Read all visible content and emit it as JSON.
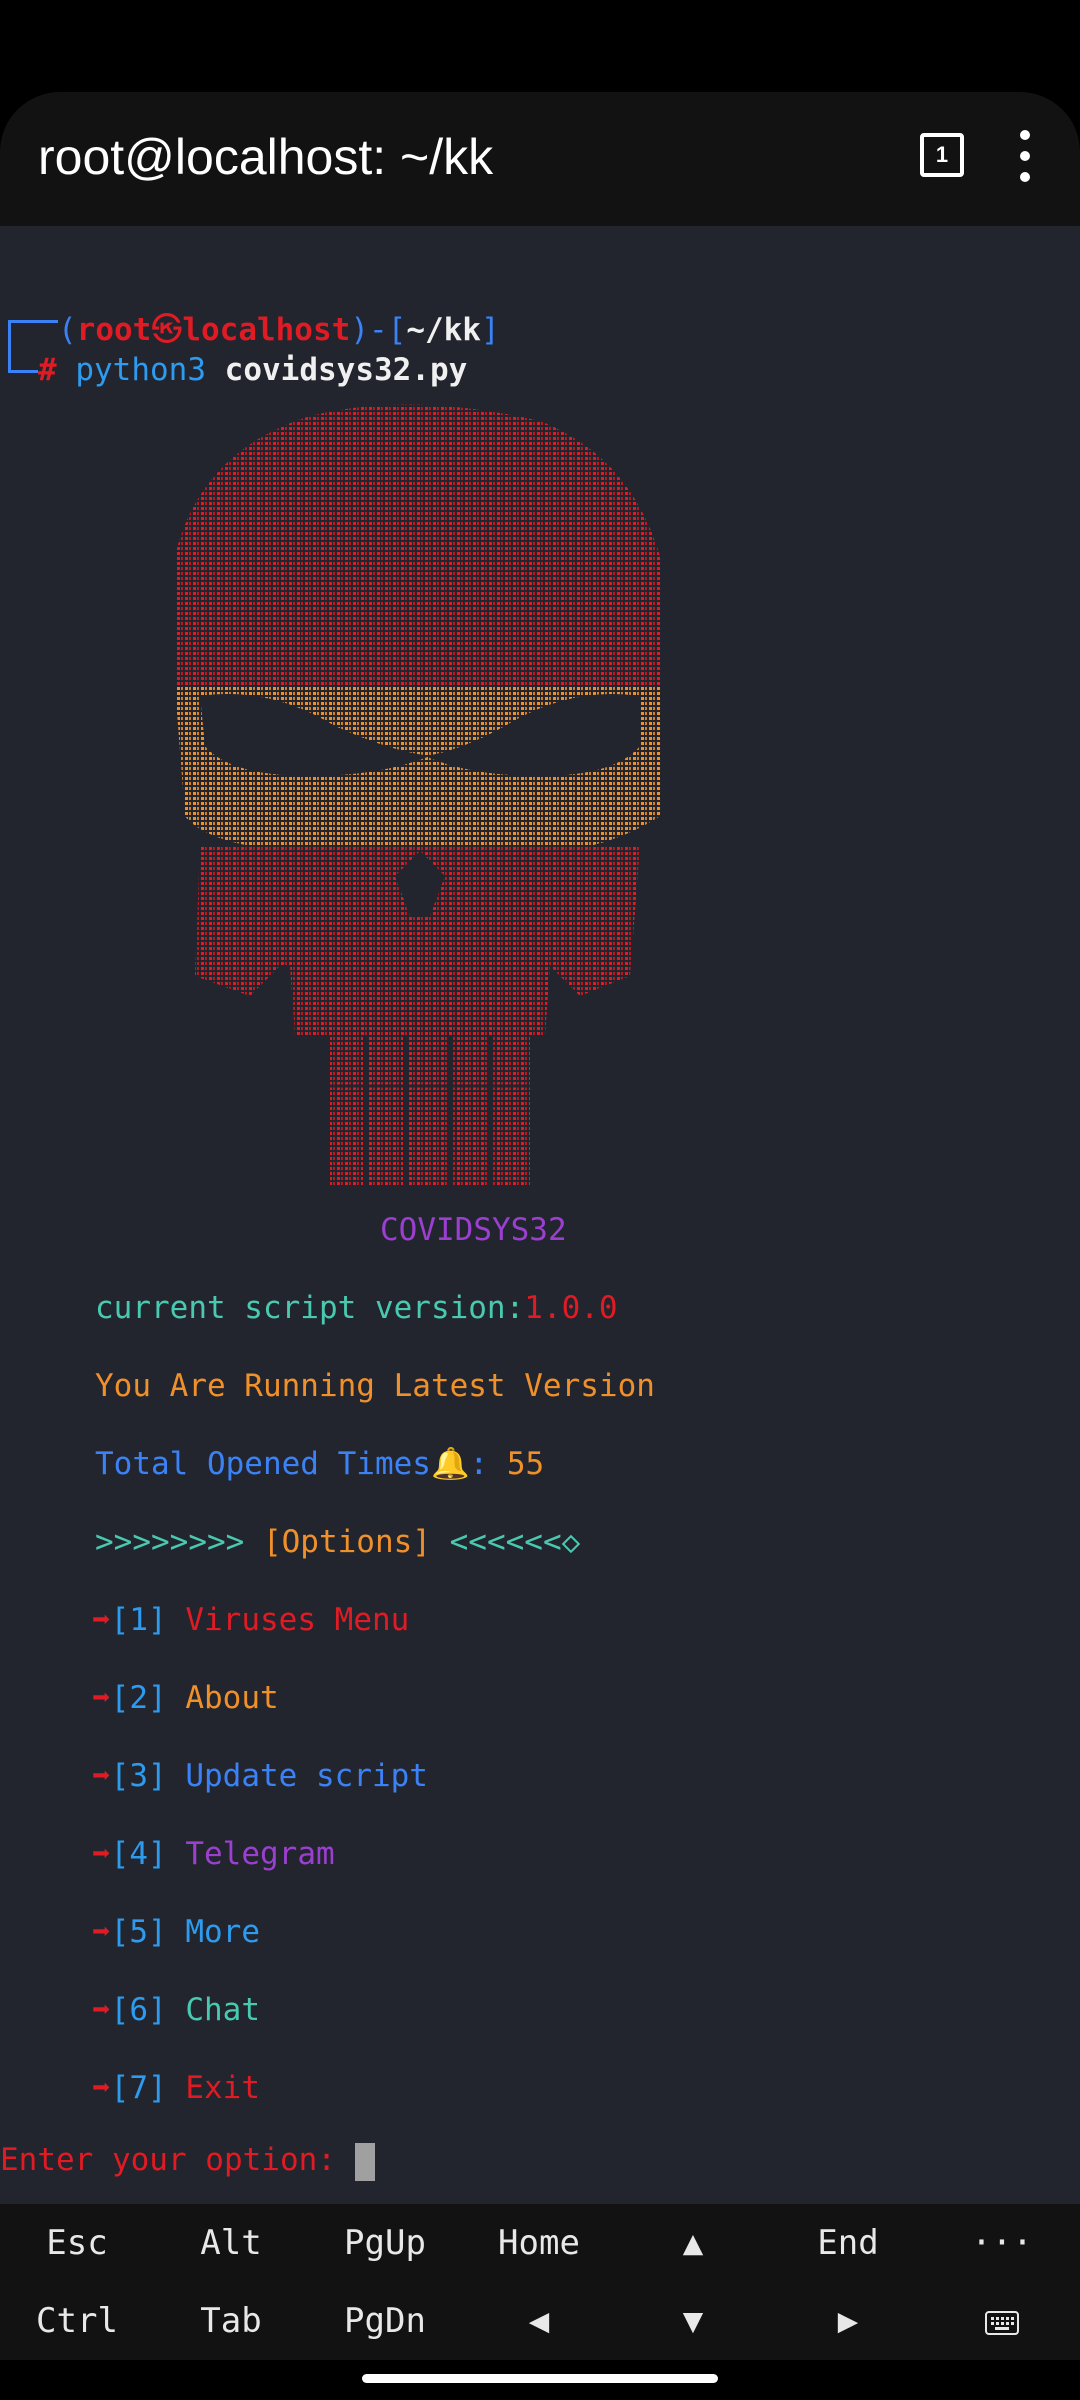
{
  "app": {
    "title": "root@localhost: ~/kk",
    "tab_count": "1"
  },
  "prompt": {
    "open": "(",
    "user": "root",
    "at": "㉿",
    "host": "localhost",
    "close_open": ")-[",
    "dir": "~/kk",
    "close": "]",
    "hash": "#",
    "command": "python3",
    "arg": "covidsys32.py"
  },
  "banner": "COVIDSYS32",
  "info": {
    "version_label": "current script version:",
    "version_value": "1.0.0",
    "status": "You Are Running Latest Version",
    "opened_label": "Total Opened Times🔔:",
    "opened_value": "55"
  },
  "options_header": {
    "left": ">>>>>>>>",
    "label": "[Options]",
    "right": "<<<<<<◇"
  },
  "menu": [
    {
      "num": "[1]",
      "label": "Viruses Menu",
      "color": "#e01b24"
    },
    {
      "num": "[2]",
      "label": "About",
      "color": "#f0902a"
    },
    {
      "num": "[3]",
      "label": "Update script",
      "color": "#3b82f6"
    },
    {
      "num": "[4]",
      "label": "Telegram",
      "color": "#9b3fd1"
    },
    {
      "num": "[5]",
      "label": "More",
      "color": "#2d9bf0"
    },
    {
      "num": "[6]",
      "label": "Chat",
      "color": "#48c9b0"
    },
    {
      "num": "[7]",
      "label": "Exit",
      "color": "#e01b24"
    }
  ],
  "input_prompt": "Enter your option: ",
  "extra_keys": {
    "row1": [
      "Esc",
      "Alt",
      "PgUp",
      "Home",
      "▲",
      "End",
      "···"
    ],
    "row2": [
      "Ctrl",
      "Tab",
      "PgDn",
      "◀",
      "▼",
      "▶",
      "keyboard-icon"
    ]
  }
}
